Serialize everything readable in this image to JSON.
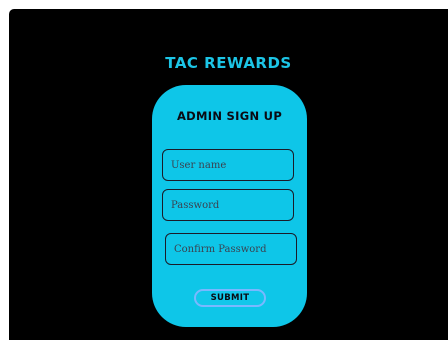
{
  "brand": {
    "title": "TAC REWARDS"
  },
  "signup_form": {
    "title": "ADMIN SIGN UP",
    "username_placeholder": "User name",
    "password_placeholder": "Password",
    "confirm_placeholder": "Confirm Password",
    "submit_label": "SUBMIT"
  },
  "colors": {
    "background": "#000000",
    "accent": "#0ec6e8",
    "submit_border": "#7ab8ff",
    "text_dark": "#0a0a12"
  }
}
